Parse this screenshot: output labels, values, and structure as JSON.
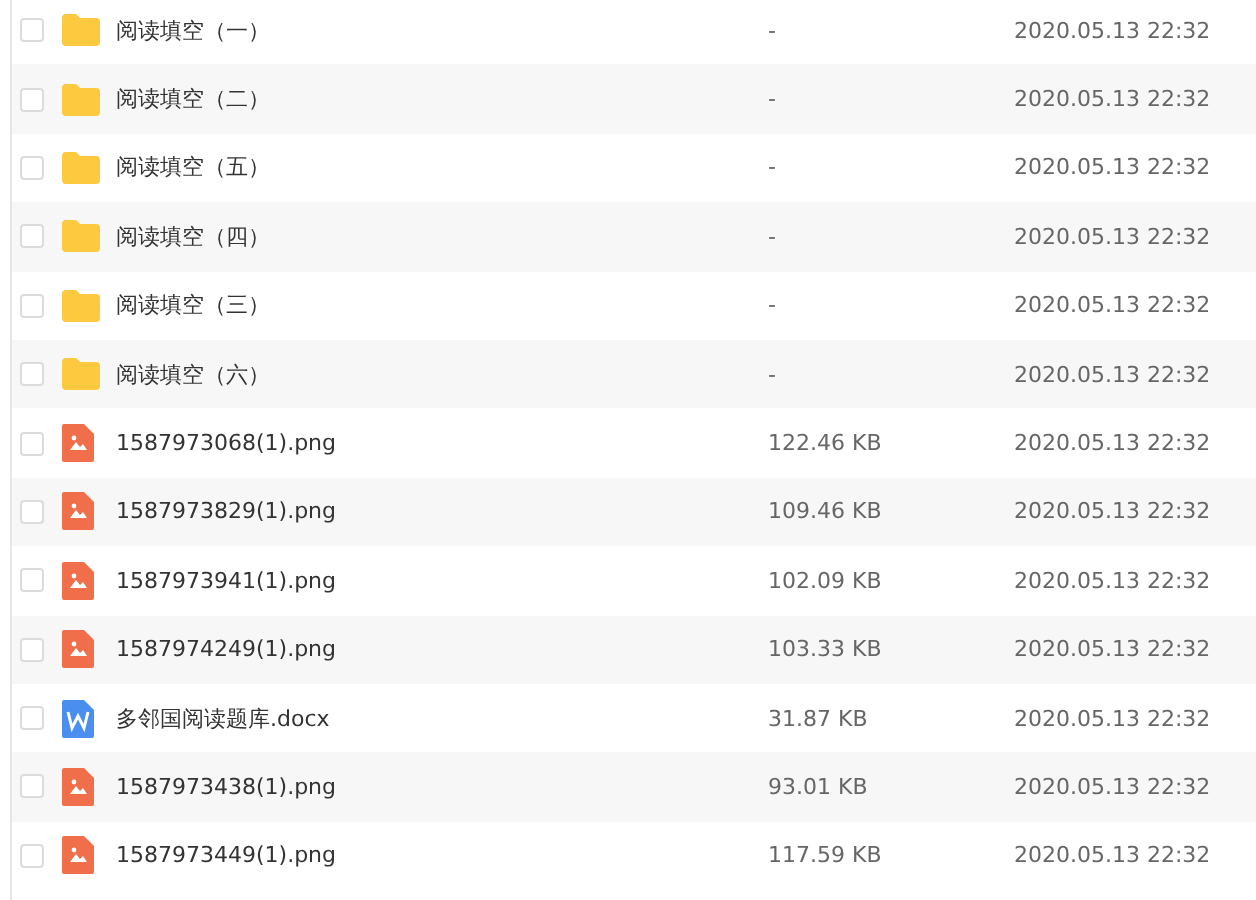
{
  "files": [
    {
      "kind": "folder",
      "name": "阅读填空（一）",
      "size": "-",
      "modified": "2020.05.13 22:32",
      "checked": false
    },
    {
      "kind": "folder",
      "name": "阅读填空（二）",
      "size": "-",
      "modified": "2020.05.13 22:32",
      "checked": false
    },
    {
      "kind": "folder",
      "name": "阅读填空（五）",
      "size": "-",
      "modified": "2020.05.13 22:32",
      "checked": false
    },
    {
      "kind": "folder",
      "name": "阅读填空（四）",
      "size": "-",
      "modified": "2020.05.13 22:32",
      "checked": false
    },
    {
      "kind": "folder",
      "name": "阅读填空（三）",
      "size": "-",
      "modified": "2020.05.13 22:32",
      "checked": false
    },
    {
      "kind": "folder",
      "name": "阅读填空（六）",
      "size": "-",
      "modified": "2020.05.13 22:32",
      "checked": false
    },
    {
      "kind": "image",
      "name": "1587973068(1).png",
      "size": "122.46 KB",
      "modified": "2020.05.13 22:32",
      "checked": false
    },
    {
      "kind": "image",
      "name": "1587973829(1).png",
      "size": "109.46 KB",
      "modified": "2020.05.13 22:32",
      "checked": false
    },
    {
      "kind": "image",
      "name": "1587973941(1).png",
      "size": "102.09 KB",
      "modified": "2020.05.13 22:32",
      "checked": false
    },
    {
      "kind": "image",
      "name": "1587974249(1).png",
      "size": "103.33 KB",
      "modified": "2020.05.13 22:32",
      "checked": false
    },
    {
      "kind": "document",
      "name": "多邻国阅读题库.docx",
      "size": "31.87 KB",
      "modified": "2020.05.13 22:32",
      "checked": false
    },
    {
      "kind": "image",
      "name": "1587973438(1).png",
      "size": "93.01 KB",
      "modified": "2020.05.13 22:32",
      "checked": false
    },
    {
      "kind": "image",
      "name": "1587973449(1).png",
      "size": "117.59 KB",
      "modified": "2020.05.13 22:32",
      "checked": false
    }
  ]
}
